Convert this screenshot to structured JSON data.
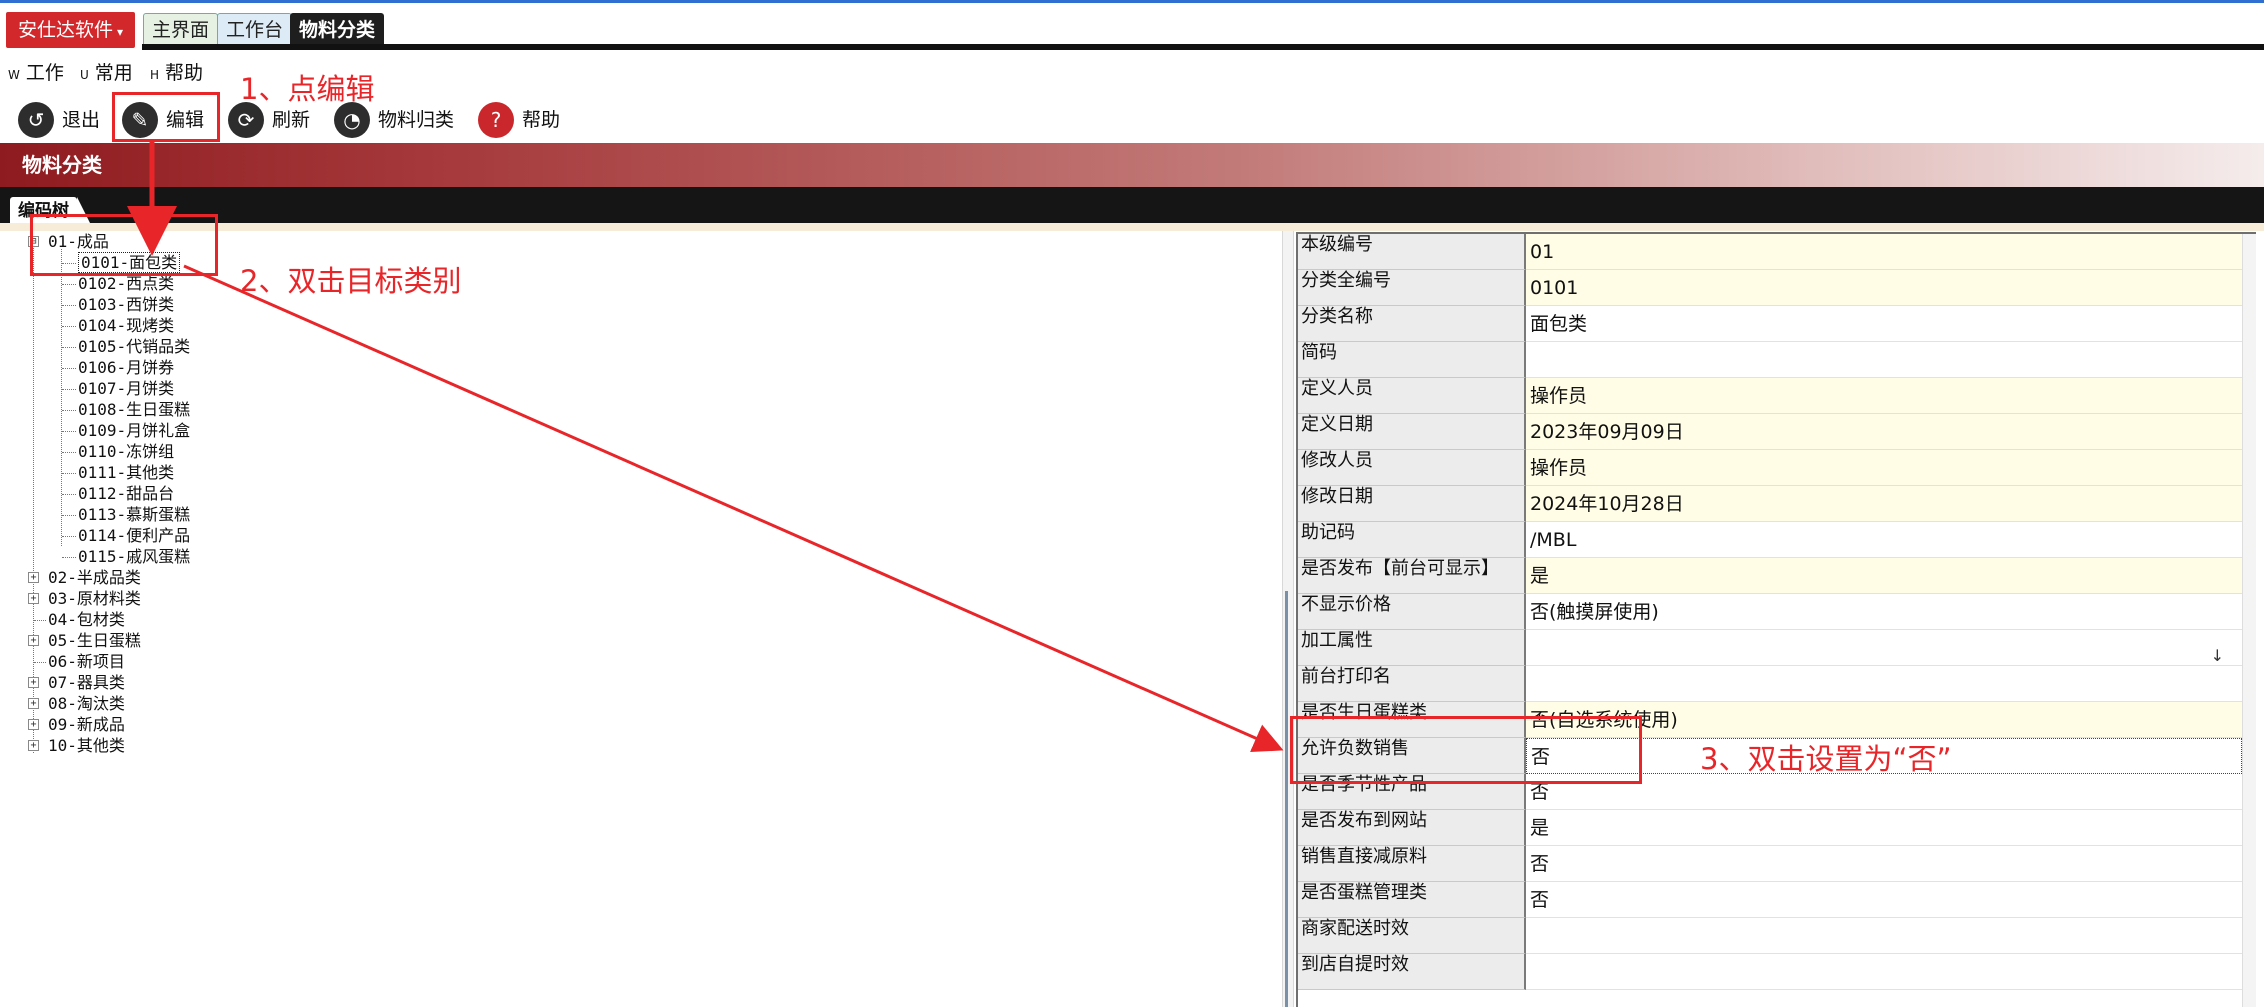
{
  "app": {
    "brand": "安仕达软件",
    "brand_caret": "▾"
  },
  "tabs": [
    {
      "label": "主界面"
    },
    {
      "label": "工作台"
    },
    {
      "label": "物料分类"
    }
  ],
  "menu": [
    {
      "key": "W",
      "label": "工作"
    },
    {
      "key": "U",
      "label": "常用"
    },
    {
      "key": "H",
      "label": "帮助"
    }
  ],
  "toolbar": [
    {
      "label": "退出",
      "icon": "exit-icon",
      "glyph": "↺"
    },
    {
      "label": "编辑",
      "icon": "edit-icon",
      "glyph": "✎"
    },
    {
      "label": "刷新",
      "icon": "refresh-icon",
      "glyph": "⟳"
    },
    {
      "label": "物料归类",
      "icon": "classify-icon",
      "glyph": "◔"
    },
    {
      "label": "帮助",
      "icon": "help-icon",
      "glyph": "?"
    }
  ],
  "banner": {
    "title": "物料分类"
  },
  "tree_tab": "编码树",
  "tree": {
    "root_open": {
      "label": "01-成品",
      "toggle": "⊟"
    },
    "children": [
      "0101-面包类",
      "0102-西点类",
      "0103-西饼类",
      "0104-现烤类",
      "0105-代销品类",
      "0106-月饼券",
      "0107-月饼类",
      "0108-生日蛋糕",
      "0109-月饼礼盒",
      "0110-冻饼组",
      "0111-其他类",
      "0112-甜品台",
      "0113-慕斯蛋糕",
      "0114-便利产品",
      "0115-戚风蛋糕"
    ],
    "others": [
      {
        "label": "02-半成品类",
        "toggle": "+"
      },
      {
        "label": "03-原材料类",
        "toggle": "+"
      },
      {
        "label": "04-包材类",
        "toggle": ""
      },
      {
        "label": "05-生日蛋糕",
        "toggle": "+"
      },
      {
        "label": "06-新项目",
        "toggle": ""
      },
      {
        "label": "07-器具类",
        "toggle": "+"
      },
      {
        "label": "08-淘汰类",
        "toggle": "+"
      },
      {
        "label": "09-新成品",
        "toggle": "+"
      },
      {
        "label": "10-其他类",
        "toggle": "+"
      }
    ]
  },
  "properties": [
    {
      "label": "本级编号",
      "value": "01",
      "style": "y"
    },
    {
      "label": "分类全编号",
      "value": "0101",
      "style": "y"
    },
    {
      "label": "分类名称",
      "value": "面包类",
      "style": "w"
    },
    {
      "label": "简码",
      "value": "",
      "style": "w"
    },
    {
      "label": "定义人员",
      "value": "操作员",
      "style": "y"
    },
    {
      "label": "定义日期",
      "value": "2023年09月09日",
      "style": "y"
    },
    {
      "label": "修改人员",
      "value": "操作员",
      "style": "y"
    },
    {
      "label": "修改日期",
      "value": "2024年10月28日",
      "style": "y"
    },
    {
      "label": "助记码",
      "value": "/MBL",
      "style": "w"
    },
    {
      "label": "是否发布【前台可显示】",
      "value": "是",
      "style": "y"
    },
    {
      "label": "不显示价格",
      "value": "否(触摸屏使用)",
      "style": "w"
    },
    {
      "label": "加工属性",
      "value": "",
      "style": "w",
      "dropdown": "↓"
    },
    {
      "label": "前台打印名",
      "value": "",
      "style": "w"
    },
    {
      "label": "是否生日蛋糕类",
      "value": "否(自选系统使用)",
      "style": "y"
    },
    {
      "label": "允许负数销售",
      "value": "否",
      "style": "focus"
    },
    {
      "label": "是否季节性产品",
      "value": "否",
      "style": "w"
    },
    {
      "label": "是否发布到网站",
      "value": "是",
      "style": "w"
    },
    {
      "label": "销售直接减原料",
      "value": "否",
      "style": "w"
    },
    {
      "label": "是否蛋糕管理类",
      "value": "否",
      "style": "w"
    },
    {
      "label": "商家配送时效",
      "value": "",
      "style": "w"
    },
    {
      "label": "到店自提时效",
      "value": "",
      "style": "w"
    }
  ],
  "annotations": {
    "step1": "1、点编辑",
    "step2": "2、双击目标类别",
    "step3": "3、双击设置为“否”"
  },
  "colors": {
    "annotation": "#e8262a",
    "brand": "#d2282c",
    "banner": "#8e1b1f"
  }
}
